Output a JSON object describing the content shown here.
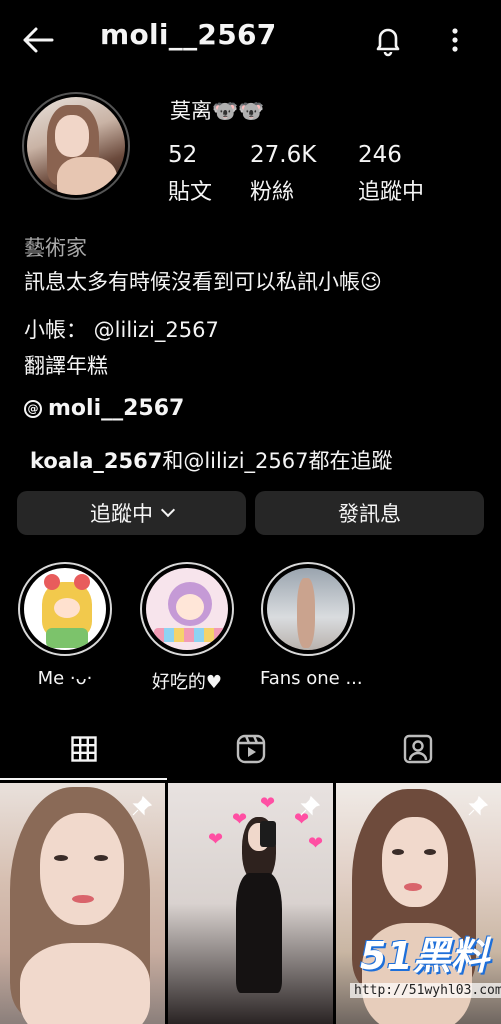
{
  "header": {
    "username": "moli__2567",
    "back_icon": "arrow-left-icon",
    "bell_icon": "bell-icon",
    "more_icon": "more-vertical-icon"
  },
  "profile": {
    "display_name": "莫离🐨🐨",
    "stats": [
      {
        "value": "52",
        "label": "貼文"
      },
      {
        "value": "27.6K",
        "label": "粉絲"
      },
      {
        "value": "246",
        "label": "追蹤中"
      }
    ],
    "category": "藝術家",
    "bio_lines": [
      "訊息太多有時候沒看到可以私訊小帳😉",
      "小帳： @lilizi_2567",
      "翻譯年糕"
    ],
    "threads_handle": "moli__2567",
    "followed_by_user": "koala_2567",
    "followed_by_rest": "和@lilizi_2567都在追蹤"
  },
  "buttons": {
    "following": "追蹤中",
    "message": "發訊息"
  },
  "highlights": [
    {
      "label": "Me ·ᴗ·"
    },
    {
      "label": "好吃的♥"
    },
    {
      "label": "Fans one ..."
    }
  ],
  "tabs": [
    {
      "name": "grid",
      "icon": "grid-icon",
      "active": true
    },
    {
      "name": "reels",
      "icon": "reels-icon",
      "active": false
    },
    {
      "name": "tagged",
      "icon": "tagged-icon",
      "active": false
    }
  ],
  "watermark": {
    "logo": "51黑料",
    "url": "http://51wyhl03.com"
  },
  "colors": {
    "background": "#000000",
    "button_bg": "#262626",
    "text": "#f5f5f5",
    "muted": "#a8a8a8"
  }
}
